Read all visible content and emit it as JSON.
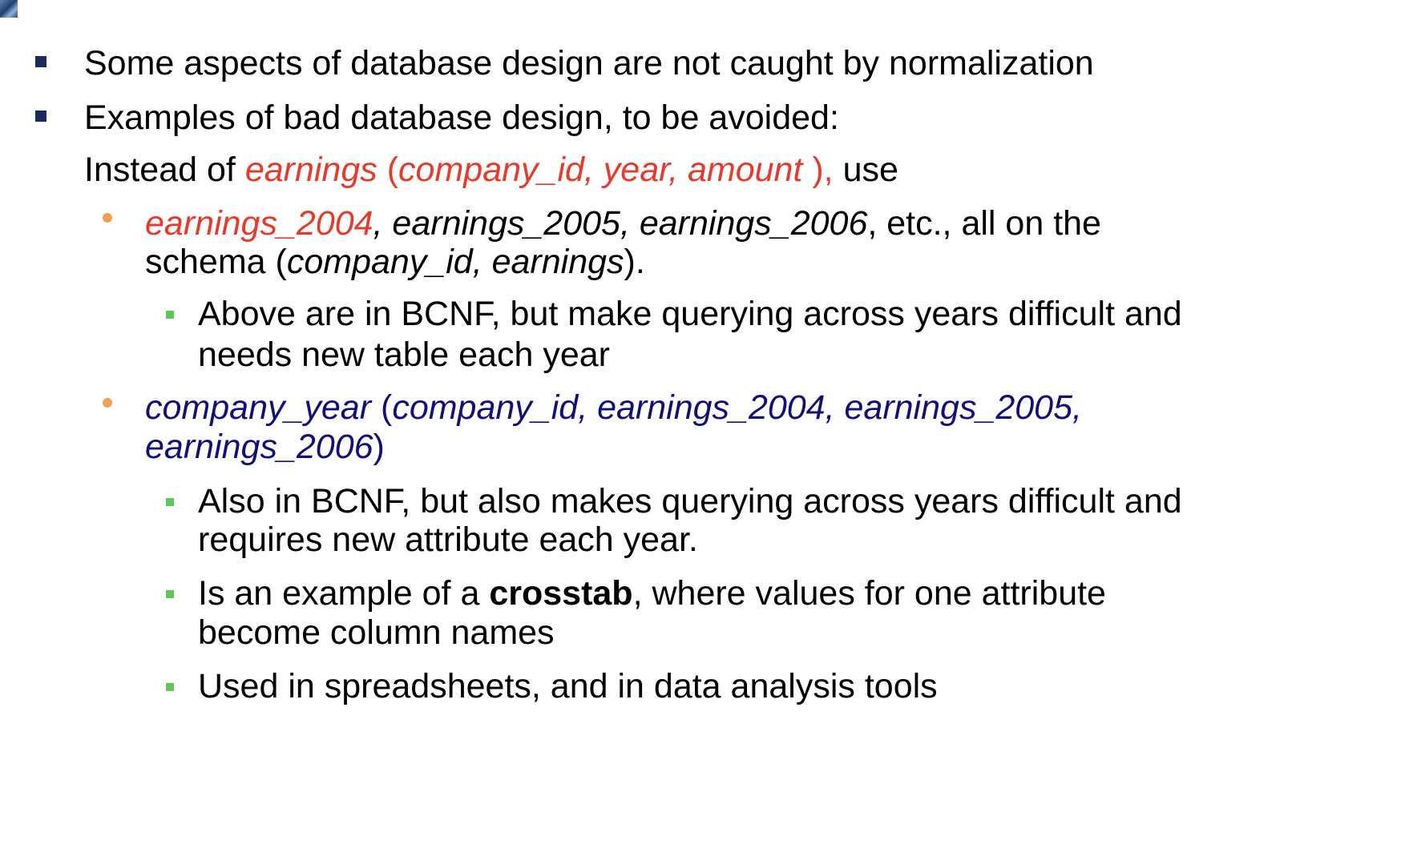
{
  "colors": {
    "level1_bullet": "#1a2a5e",
    "level2_bullet": "#f0a050",
    "level3_bullet": "#5cc85c",
    "red_text": "#e8392a",
    "navy_text": "#10107a"
  },
  "bullet1": {
    "text": "Some aspects of database design are not caught by normalization"
  },
  "bullet2": {
    "text": "Examples of bad database design, to be avoided:"
  },
  "instead": {
    "prefix": "Instead of ",
    "relation": "earnings",
    "open": " (",
    "attrs": "company_id, year, amount",
    "close": " ),",
    "suffix": " use"
  },
  "sub1": {
    "name_red": "earnings_2004",
    "names_rest": ", earnings_2005, earnings_2006",
    "text_after": ", etc., all on the",
    "line2_prefix": "schema (",
    "line2_attrs": "company_id, earnings",
    "line2_suffix": ")."
  },
  "sub1_note": {
    "line1": "Above are in BCNF, but make querying across years difficult and",
    "line2": "needs new table each year"
  },
  "sub2": {
    "relation": "company_year",
    "open": " (",
    "attrs_line1": "company_id, earnings_2004, earnings_2005,",
    "attrs_line2": "earnings_2006",
    "close": ")"
  },
  "sub2_notes": {
    "n1_line1": "Also in BCNF, but also makes querying across years difficult and",
    "n1_line2": "requires new attribute each year.",
    "n2_prefix": "Is an example of a ",
    "n2_bold": "crosstab",
    "n2_suffix": ", where values for one attribute",
    "n2_line2": "become column names",
    "n3": "Used in spreadsheets, and in data analysis tools"
  }
}
